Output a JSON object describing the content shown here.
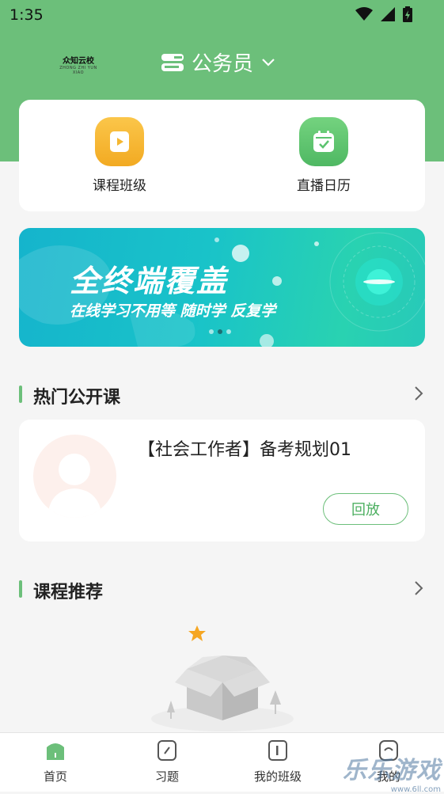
{
  "status_bar": {
    "time": "1:35",
    "icons": [
      "wifi-icon",
      "signal-icon",
      "battery-icon"
    ]
  },
  "logo": {
    "main": "众知云校",
    "sub": "ZHONG ZHI YUN XIAO"
  },
  "header": {
    "subject": "公务员"
  },
  "quick_actions": [
    {
      "label": "课程班级",
      "icon": "video-icon",
      "color": "#f5b731"
    },
    {
      "label": "直播日历",
      "icon": "calendar-icon",
      "color": "#5cc36f"
    }
  ],
  "banner": {
    "title": "全终端覆盖",
    "subtitle": "在线学习不用等  随时学  反复学",
    "dots": 3,
    "active_dot": 1
  },
  "hot_section": {
    "title": "热门公开课"
  },
  "hot_course": {
    "title": "【社会工作者】备考规划01",
    "button": "回放"
  },
  "recommend_section": {
    "title": "课程推荐"
  },
  "tabs": [
    {
      "label": "首页",
      "icon": "home-icon",
      "active": true
    },
    {
      "label": "习题",
      "icon": "exercise-icon",
      "active": false
    },
    {
      "label": "我的班级",
      "icon": "class-icon",
      "active": false
    },
    {
      "label": "我的",
      "icon": "profile-icon",
      "active": false
    }
  ],
  "watermark": {
    "main": "乐乐游戏",
    "sub": "www.6ll.com"
  },
  "colors": {
    "brand_green": "#6cbf7a",
    "orange": "#f5b731",
    "star": "#f5a623"
  }
}
